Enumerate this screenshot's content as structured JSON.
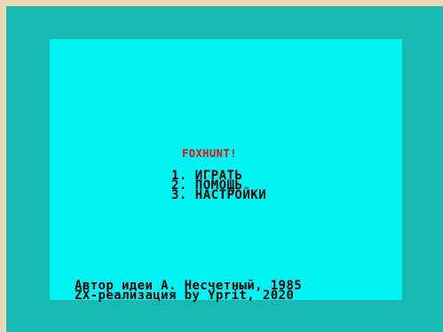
{
  "game": {
    "title": "FOXHUNT!",
    "menu": [
      {
        "label": "1. ИГРАТЬ"
      },
      {
        "label": "2. ПОМОЩЬ"
      },
      {
        "label": "3. НАСТРОЙКИ"
      }
    ],
    "credits": [
      "Автор идеи А. Несчетный, 1985",
      "ZX-реализация by Yprit, 2020"
    ]
  },
  "colors": {
    "border": "#18b9b0",
    "paper": "#00f2f2",
    "title": "#e01010",
    "ink": "#000000"
  }
}
